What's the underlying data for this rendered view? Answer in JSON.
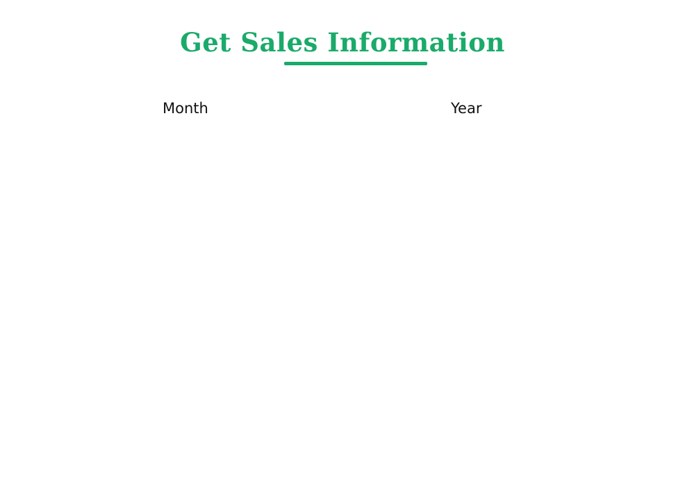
{
  "page": {
    "title": "Get Sales Information",
    "accent_color": "#1aaa6a"
  },
  "form": {
    "month_label": "Month",
    "year_label": "Year"
  }
}
